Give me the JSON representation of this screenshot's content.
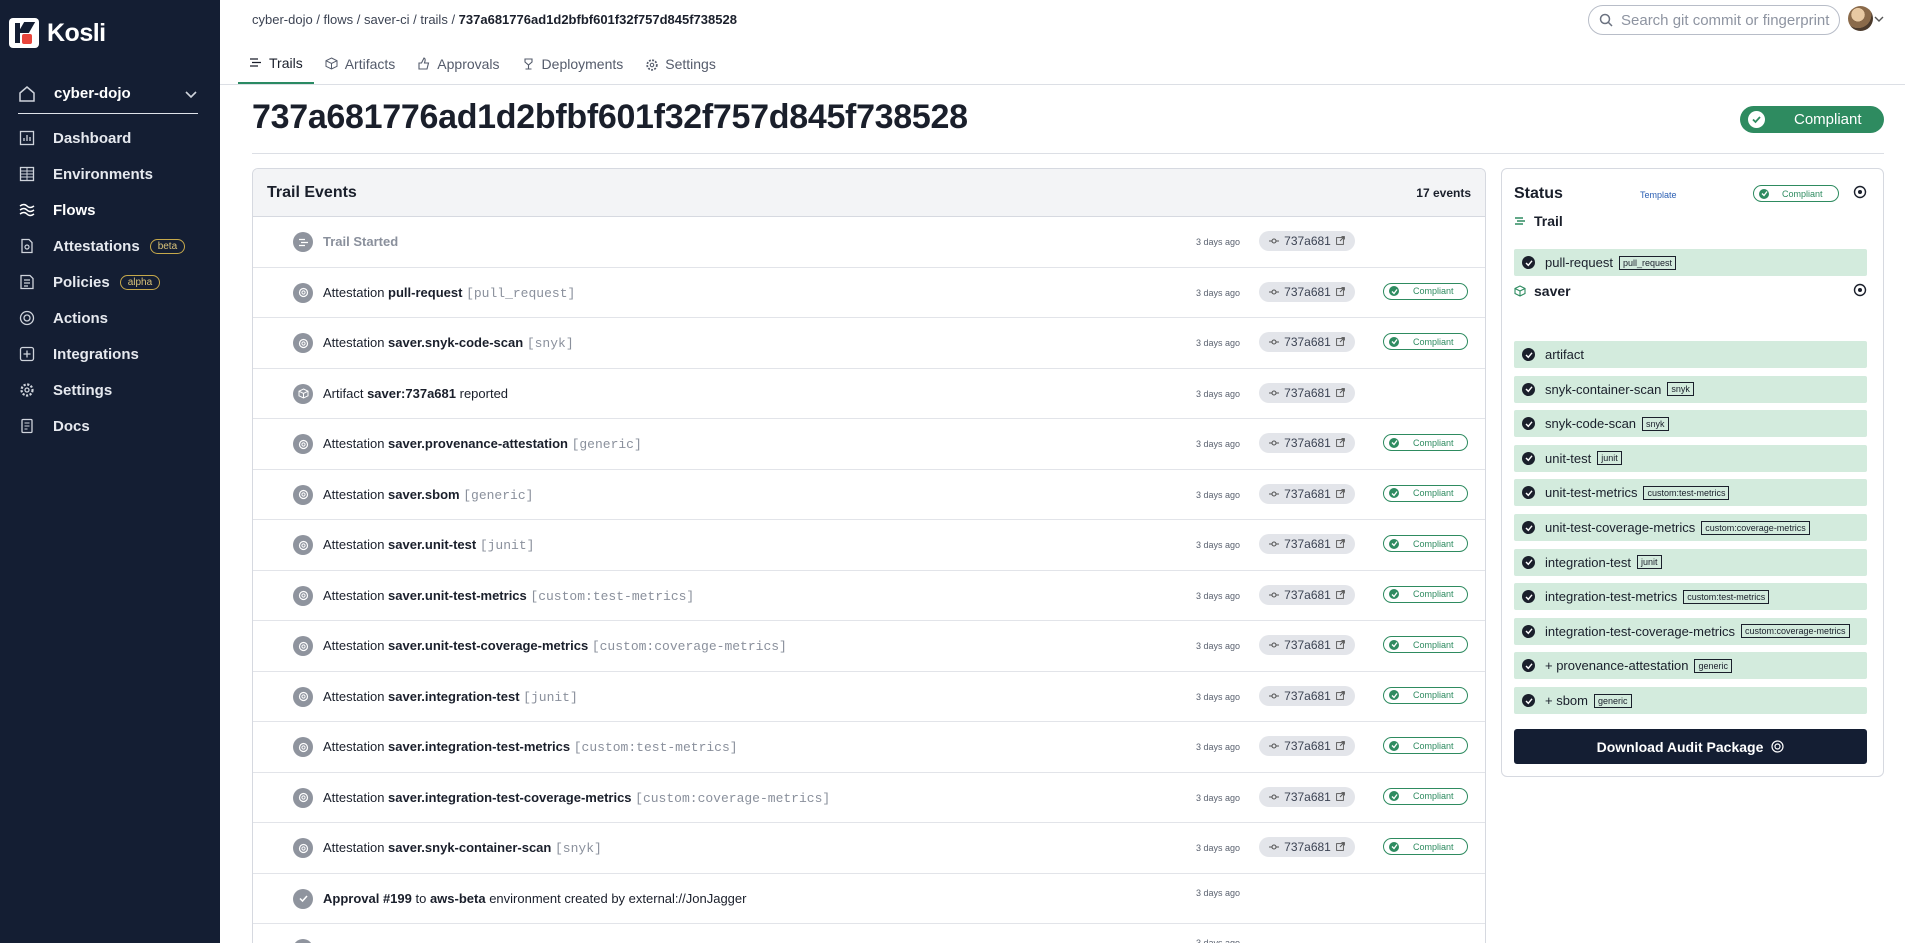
{
  "app": {
    "name": "Kosli"
  },
  "org": {
    "name": "cyber-dojo"
  },
  "nav": [
    {
      "label": "Dashboard",
      "icon": "chart-icon"
    },
    {
      "label": "Environments",
      "icon": "grid-icon"
    },
    {
      "label": "Flows",
      "icon": "flows-icon",
      "active": true
    },
    {
      "label": "Attestations",
      "icon": "attestations-icon",
      "badge": "beta"
    },
    {
      "label": "Policies",
      "icon": "policies-icon",
      "badge": "alpha"
    },
    {
      "label": "Actions",
      "icon": "actions-icon"
    },
    {
      "label": "Integrations",
      "icon": "integrations-icon"
    },
    {
      "label": "Settings",
      "icon": "gear-icon"
    },
    {
      "label": "Docs",
      "icon": "docs-icon"
    }
  ],
  "breadcrumb": {
    "org": "cyber-dojo",
    "sep": " / ",
    "flows": "flows",
    "flow": "saver-ci",
    "trails": "trails",
    "trail": "737a681776ad1d2bfbf601f32f757d845f738528"
  },
  "search": {
    "placeholder": "Search git commit or fingerprint"
  },
  "tabs": [
    {
      "label": "Trails",
      "active": true
    },
    {
      "label": "Artifacts"
    },
    {
      "label": "Approvals"
    },
    {
      "label": "Deployments"
    },
    {
      "label": "Settings"
    }
  ],
  "page": {
    "title": "737a681776ad1d2bfbf601f32f757d845f738528",
    "status": "Compliant"
  },
  "events": {
    "heading": "Trail Events",
    "count": "17 events",
    "items": [
      {
        "kind": "started",
        "prefix": "Trail Started",
        "name": "",
        "type": "",
        "suffix": "",
        "time": "3 days ago",
        "commit": "737a681",
        "status": ""
      },
      {
        "kind": "attestation",
        "prefix": "Attestation ",
        "name": "pull-request",
        "type": "[pull_request]",
        "suffix": "",
        "time": "3 days ago",
        "commit": "737a681",
        "status": "Compliant"
      },
      {
        "kind": "attestation",
        "prefix": "Attestation ",
        "name": "saver.snyk-code-scan",
        "type": "[snyk]",
        "suffix": "",
        "time": "3 days ago",
        "commit": "737a681",
        "status": "Compliant"
      },
      {
        "kind": "artifact",
        "prefix": "Artifact ",
        "name": "saver:737a681",
        "type": "",
        "suffix": " reported",
        "time": "3 days ago",
        "commit": "737a681",
        "status": ""
      },
      {
        "kind": "attestation",
        "prefix": "Attestation ",
        "name": "saver.provenance-attestation",
        "type": "[generic]",
        "suffix": "",
        "time": "3 days ago",
        "commit": "737a681",
        "status": "Compliant"
      },
      {
        "kind": "attestation",
        "prefix": "Attestation ",
        "name": "saver.sbom",
        "type": "[generic]",
        "suffix": "",
        "time": "3 days ago",
        "commit": "737a681",
        "status": "Compliant"
      },
      {
        "kind": "attestation",
        "prefix": "Attestation ",
        "name": "saver.unit-test",
        "type": "[junit]",
        "suffix": "",
        "time": "3 days ago",
        "commit": "737a681",
        "status": "Compliant"
      },
      {
        "kind": "attestation",
        "prefix": "Attestation ",
        "name": "saver.unit-test-metrics",
        "type": "[custom:test-metrics]",
        "suffix": "",
        "time": "3 days ago",
        "commit": "737a681",
        "status": "Compliant"
      },
      {
        "kind": "attestation",
        "prefix": "Attestation ",
        "name": "saver.unit-test-coverage-metrics",
        "type": "[custom:coverage-metrics]",
        "suffix": "",
        "time": "3 days ago",
        "commit": "737a681",
        "status": "Compliant"
      },
      {
        "kind": "attestation",
        "prefix": "Attestation ",
        "name": "saver.integration-test",
        "type": "[junit]",
        "suffix": "",
        "time": "3 days ago",
        "commit": "737a681",
        "status": "Compliant"
      },
      {
        "kind": "attestation",
        "prefix": "Attestation ",
        "name": "saver.integration-test-metrics",
        "type": "[custom:test-metrics]",
        "suffix": "",
        "time": "3 days ago",
        "commit": "737a681",
        "status": "Compliant"
      },
      {
        "kind": "attestation",
        "prefix": "Attestation ",
        "name": "saver.integration-test-coverage-metrics",
        "type": "[custom:coverage-metrics]",
        "suffix": "",
        "time": "3 days ago",
        "commit": "737a681",
        "status": "Compliant"
      },
      {
        "kind": "attestation",
        "prefix": "Attestation ",
        "name": "saver.snyk-container-scan",
        "type": "[snyk]",
        "suffix": "",
        "time": "3 days ago",
        "commit": "737a681",
        "status": "Compliant"
      },
      {
        "kind": "approval",
        "prefix": "",
        "name": "Approval #199",
        "type": "",
        "suffix": " environment created by external://JonJagger",
        "mid": " to ",
        "env": "aws-beta",
        "time": "3 days ago",
        "commit": "",
        "status": ""
      },
      {
        "kind": "deployment",
        "prefix": "",
        "name": "",
        "type": "",
        "suffix": "",
        "time": "3 days ago",
        "commit": "",
        "status": ""
      }
    ]
  },
  "status_panel": {
    "heading": "Status",
    "template_link": "Template",
    "status": "Compliant",
    "trail_section": "Trail",
    "trail_items": [
      {
        "name": "pull-request",
        "tag": "pull_request"
      }
    ],
    "artifact_section": "saver",
    "artifact_items": [
      {
        "name": "artifact",
        "tag": ""
      },
      {
        "name": "snyk-container-scan",
        "tag": "snyk"
      },
      {
        "name": "snyk-code-scan",
        "tag": "snyk"
      },
      {
        "name": "unit-test",
        "tag": "junit"
      },
      {
        "name": "unit-test-metrics",
        "tag": "custom:test-metrics"
      },
      {
        "name": "unit-test-coverage-metrics",
        "tag": "custom:coverage-metrics"
      },
      {
        "name": "integration-test",
        "tag": "junit"
      },
      {
        "name": "integration-test-metrics",
        "tag": "custom:test-metrics"
      },
      {
        "name": "integration-test-coverage-metrics",
        "tag": "custom:coverage-metrics"
      },
      {
        "name": "+ provenance-attestation",
        "tag": "generic"
      },
      {
        "name": "+ sbom",
        "tag": "generic"
      }
    ],
    "download_label": "Download Audit Package"
  },
  "colors": {
    "sidebar": "#141e33",
    "accent": "#2e8b60",
    "row_green": "#d3ebdd"
  }
}
